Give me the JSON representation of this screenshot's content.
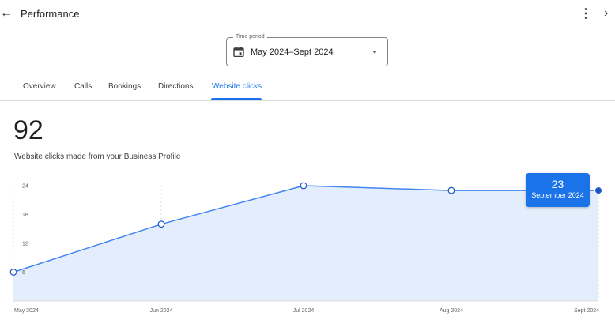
{
  "header": {
    "title": "Performance",
    "back_icon": "arrow-back-icon",
    "more_icon": "more-vert-icon",
    "close_icon": "chevron-right-icon"
  },
  "time_period": {
    "label": "Time period",
    "value": "May 2024–Sept 2024",
    "icon": "calendar-icon"
  },
  "tabs": [
    {
      "label": "Overview"
    },
    {
      "label": "Calls"
    },
    {
      "label": "Bookings"
    },
    {
      "label": "Directions"
    },
    {
      "label": "Website clicks"
    }
  ],
  "active_tab": "Website clicks",
  "summary": {
    "total": "92",
    "caption": "Website clicks made from your Business Profile"
  },
  "tooltip": {
    "value": "23",
    "date": "September 2024"
  },
  "colors": {
    "accent": "#1a73e8",
    "line": "#4285f4",
    "area_fill": "#e3edfb",
    "highlight_point": "#1a56c4"
  },
  "chart_data": {
    "type": "area",
    "categories": [
      "May 2024",
      "Jun 2024",
      "Jul 2024",
      "Aug 2024",
      "Sept 2024"
    ],
    "values": [
      6,
      16,
      24,
      23,
      23
    ],
    "ylim": [
      0,
      24
    ],
    "yticks": [
      6,
      12,
      18,
      24
    ],
    "highlighted_index": 4,
    "grid": "vertical-dashed"
  }
}
